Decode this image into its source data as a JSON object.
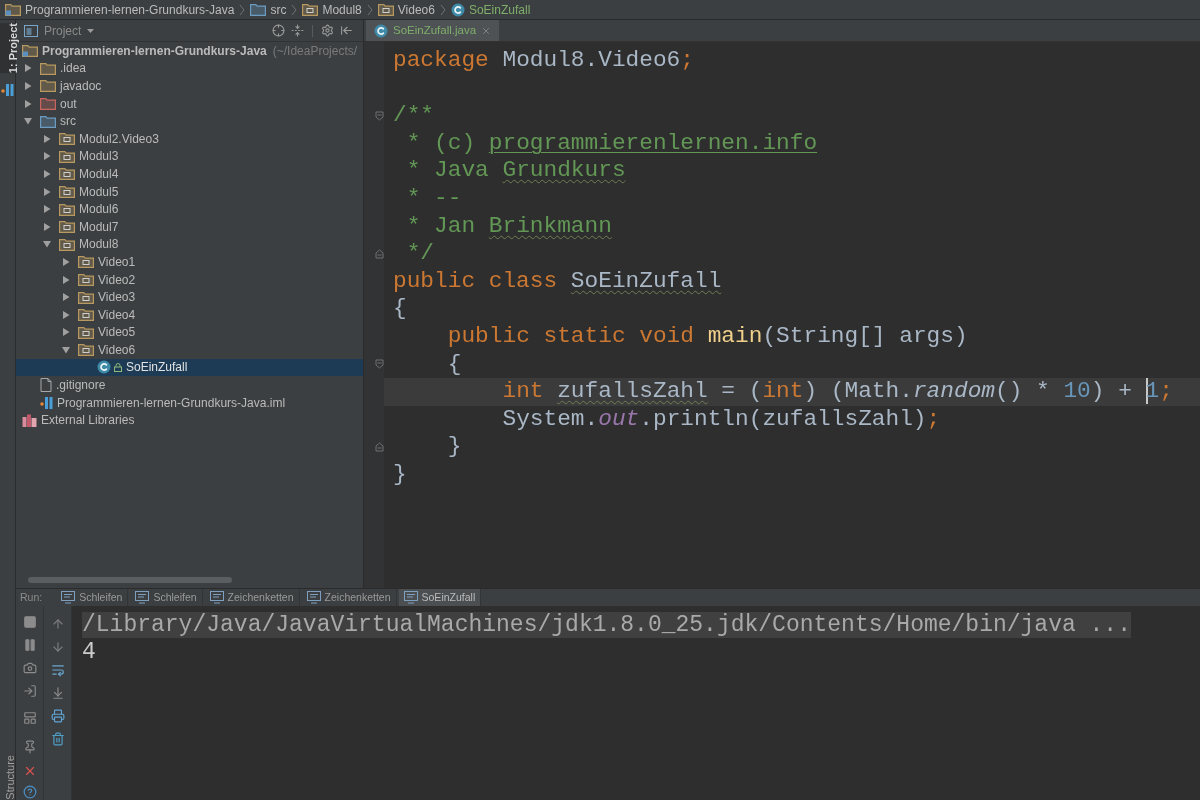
{
  "breadcrumbs": [
    {
      "label": "Programmieren-lernen-Grundkurs-Java",
      "kind": "project",
      "added": false
    },
    {
      "label": "src",
      "kind": "source-folder",
      "added": false
    },
    {
      "label": "Modul8",
      "kind": "package",
      "added": false
    },
    {
      "label": "Video6",
      "kind": "package",
      "added": false
    },
    {
      "label": "SoEinZufall",
      "kind": "class",
      "added": true
    }
  ],
  "tool_strip": {
    "top": [
      {
        "label": "1: Project",
        "selected": true
      }
    ],
    "bottom": [
      {
        "label": "Structure",
        "selected": false
      }
    ]
  },
  "project_panel": {
    "title": "Project",
    "tree": [
      {
        "label": "Programmieren-lernen-Grundkurs-Java",
        "path": "(~/IdeaProjects/",
        "kind": "project",
        "selected": false,
        "children": [
          {
            "label": ".idea",
            "kind": "folder",
            "expanded": false,
            "selected": false
          },
          {
            "label": "javadoc",
            "kind": "folder",
            "expanded": false,
            "selected": false
          },
          {
            "label": "out",
            "kind": "excluded-folder",
            "expanded": false,
            "selected": false
          },
          {
            "label": "src",
            "kind": "source-folder",
            "expanded": true,
            "selected": false,
            "children": [
              {
                "label": "Modul2.Video3",
                "kind": "package",
                "expanded": false,
                "selected": false
              },
              {
                "label": "Modul3",
                "kind": "package",
                "expanded": false,
                "selected": false
              },
              {
                "label": "Modul4",
                "kind": "package",
                "expanded": false,
                "selected": false
              },
              {
                "label": "Modul5",
                "kind": "package",
                "expanded": false,
                "selected": false
              },
              {
                "label": "Modul6",
                "kind": "package",
                "expanded": false,
                "selected": false
              },
              {
                "label": "Modul7",
                "kind": "package",
                "expanded": false,
                "selected": false
              },
              {
                "label": "Modul8",
                "kind": "package",
                "expanded": true,
                "selected": false,
                "children": [
                  {
                    "label": "Video1",
                    "kind": "package",
                    "expanded": false,
                    "selected": false
                  },
                  {
                    "label": "Video2",
                    "kind": "package",
                    "expanded": false,
                    "selected": false
                  },
                  {
                    "label": "Video3",
                    "kind": "package",
                    "expanded": false,
                    "selected": false
                  },
                  {
                    "label": "Video4",
                    "kind": "package",
                    "expanded": false,
                    "selected": false
                  },
                  {
                    "label": "Video5",
                    "kind": "package",
                    "expanded": false,
                    "selected": false
                  },
                  {
                    "label": "Video6",
                    "kind": "package",
                    "expanded": true,
                    "selected": false,
                    "children": [
                      {
                        "label": "SoEinZufall",
                        "kind": "class",
                        "selected": true
                      }
                    ]
                  }
                ]
              }
            ]
          },
          {
            "label": ".gitignore",
            "kind": "file",
            "selected": false
          },
          {
            "label": "Programmieren-lernen-Grundkurs-Java.iml",
            "kind": "module-file",
            "selected": false
          }
        ]
      },
      {
        "label": "External Libraries",
        "kind": "libraries",
        "selected": false
      }
    ]
  },
  "editor": {
    "tabs": [
      {
        "label": "SoEinZufall.java",
        "added": true,
        "selected": true
      }
    ],
    "lines": [
      {
        "kind": "code",
        "current": false,
        "tokens": [
          {
            "text": "package",
            "kind": "keyword"
          },
          {
            "text": " Modul8.Video6",
            "kind": "plain"
          },
          {
            "text": ";",
            "kind": "keyword"
          }
        ]
      },
      {
        "kind": "blank",
        "current": false
      },
      {
        "kind": "code",
        "current": false,
        "fold": {
          "kind": "start"
        },
        "tokens": [
          {
            "text": "/**",
            "kind": "comment"
          }
        ]
      },
      {
        "kind": "code",
        "current": false,
        "tokens": [
          {
            "text": " * (c) ",
            "kind": "comment"
          },
          {
            "text": "programmierenlernen.info",
            "kind": "comment_link"
          }
        ]
      },
      {
        "kind": "code",
        "current": false,
        "tokens": [
          {
            "text": " * Java ",
            "kind": "comment"
          },
          {
            "text": "Grundkurs",
            "kind": "comment_typo"
          }
        ]
      },
      {
        "kind": "code",
        "current": false,
        "tokens": [
          {
            "text": " * --",
            "kind": "comment"
          }
        ]
      },
      {
        "kind": "code",
        "current": false,
        "tokens": [
          {
            "text": " * Jan ",
            "kind": "comment"
          },
          {
            "text": "Brinkmann",
            "kind": "comment_typo"
          }
        ]
      },
      {
        "kind": "code",
        "current": false,
        "fold": {
          "kind": "end"
        },
        "tokens": [
          {
            "text": " */",
            "kind": "comment"
          }
        ]
      },
      {
        "kind": "code",
        "current": false,
        "tokens": [
          {
            "text": "public class ",
            "kind": "keyword"
          },
          {
            "text": "SoEinZufall",
            "kind": "typo"
          }
        ]
      },
      {
        "kind": "code",
        "current": false,
        "tokens": [
          {
            "text": "{",
            "kind": "plain"
          }
        ]
      },
      {
        "kind": "code",
        "current": false,
        "tokens": [
          {
            "text": "    public static void ",
            "kind": "keyword"
          },
          {
            "text": "main",
            "kind": "method_decl"
          },
          {
            "text": "(String[] args)",
            "kind": "plain"
          }
        ]
      },
      {
        "kind": "code",
        "current": false,
        "fold": {
          "kind": "start"
        },
        "tokens": [
          {
            "text": "    {",
            "kind": "plain"
          }
        ]
      },
      {
        "kind": "code",
        "current": true,
        "tokens": [
          {
            "text": "        int ",
            "kind": "keyword"
          },
          {
            "text": "zufallsZahl",
            "kind": "typo"
          },
          {
            "text": " = (",
            "kind": "plain"
          },
          {
            "text": "int",
            "kind": "keyword"
          },
          {
            "text": ") (Math.",
            "kind": "plain"
          },
          {
            "text": "random",
            "kind": "static_call"
          },
          {
            "text": "() * ",
            "kind": "plain"
          },
          {
            "text": "10",
            "kind": "number"
          },
          {
            "text": ") + ",
            "kind": "plain"
          },
          {
            "text": "1",
            "kind": "number",
            "caret_before": true
          },
          {
            "text": ";",
            "kind": "keyword"
          }
        ]
      },
      {
        "kind": "code",
        "current": false,
        "tokens": [
          {
            "text": "        System.",
            "kind": "plain"
          },
          {
            "text": "out",
            "kind": "field"
          },
          {
            "text": ".println(zufallsZahl)",
            "kind": "plain"
          },
          {
            "text": ";",
            "kind": "keyword"
          }
        ]
      },
      {
        "kind": "code",
        "current": false,
        "fold": {
          "kind": "end"
        },
        "tokens": [
          {
            "text": "    }",
            "kind": "plain"
          }
        ]
      },
      {
        "kind": "code",
        "current": false,
        "tokens": [
          {
            "text": "}",
            "kind": "plain"
          }
        ]
      }
    ]
  },
  "run": {
    "label": "Run:",
    "tabs": [
      {
        "label": "Schleifen",
        "selected": false
      },
      {
        "label": "Schleifen",
        "selected": false
      },
      {
        "label": "Zeichenketten",
        "selected": false
      },
      {
        "label": "Zeichenketten",
        "selected": false
      },
      {
        "label": "SoEinZufall",
        "selected": true
      }
    ],
    "console": [
      {
        "text": "/Library/Java/JavaVirtualMachines/jdk1.8.0_25.jdk/Contents/Home/bin/java ...",
        "kind": "command"
      },
      {
        "text": "4",
        "kind": "output"
      }
    ]
  }
}
